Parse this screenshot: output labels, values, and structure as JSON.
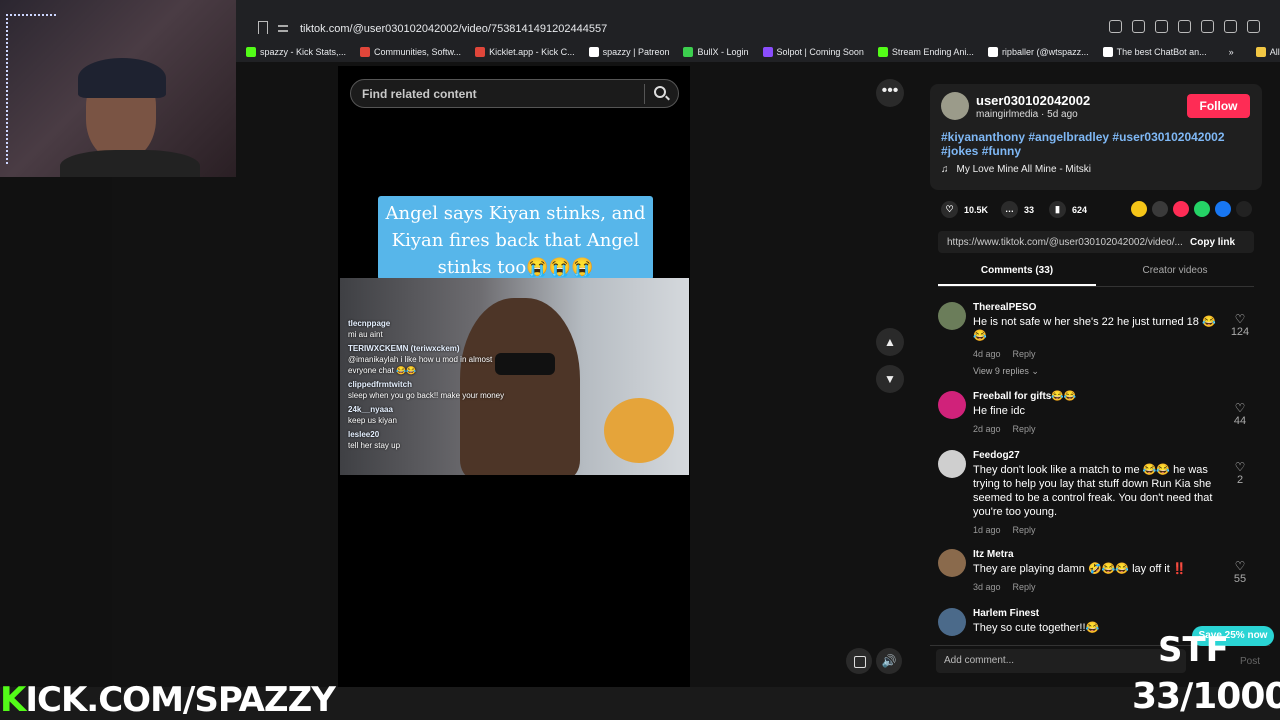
{
  "browser": {
    "url": "tiktok.com/@user030102042002/video/7538141491202444557",
    "bookmarks": [
      {
        "label": "spazzy - Kick Stats,...",
        "color": "#53fc18"
      },
      {
        "label": "Communities, Softw...",
        "color": "#e0463a"
      },
      {
        "label": "Kicklet.app - Kick C...",
        "color": "#e0463a"
      },
      {
        "label": "spazzy | Patreon",
        "color": "#ffffff"
      },
      {
        "label": "BullX - Login",
        "color": "#3ccf4e"
      },
      {
        "label": "Solpot | Coming Soon",
        "color": "#8a4dfd"
      },
      {
        "label": "Stream Ending Ani...",
        "color": "#53fc18"
      },
      {
        "label": "ripballer (@wtspazz...",
        "color": "#ffffff"
      },
      {
        "label": "The best ChatBot an...",
        "color": "#ffffff"
      },
      {
        "label": "All Bookmarks",
        "color": "#f2c744"
      }
    ],
    "bookmarks_more": "»"
  },
  "video": {
    "search_placeholder": "Find related content",
    "caption": "Angel says Kiyan stinks, and Kiyan fires back that Angel stinks too😭😭😭",
    "chat": [
      {
        "name": "tlecnppage",
        "text": "mi au aint"
      },
      {
        "name": "TERIWXCKEMN (teriwxckem)",
        "text": "@imanikaylah i like how u mod in almost evryone chat 😂😂"
      },
      {
        "name": "clippedfrmtwitch",
        "text": "sleep when you go back!! make your money"
      },
      {
        "name": "24k__nyaaa",
        "text": "keep us kiyan"
      },
      {
        "name": "leslee20",
        "text": "tell her stay up"
      }
    ]
  },
  "author": {
    "username": "user030102042002",
    "subline": "maingirlmedia · 5d ago",
    "follow_label": "Follow",
    "hashtags": "#kiyananthony #angelbradley #user030102042002 #jokes #funny",
    "music": "My Love Mine All Mine - Mitski",
    "music_icon": "♫"
  },
  "stats": {
    "likes": "10.5K",
    "comments": "33",
    "saves": "624"
  },
  "share": {
    "link": "https://www.tiktok.com/@user030102042002/video/...",
    "copy_label": "Copy link",
    "colors": [
      "#f5c518",
      "#3a3a3a",
      "#fe2c55",
      "#25d366",
      "#1877f2",
      "#222222"
    ]
  },
  "tabs": {
    "comments": "Comments (33)",
    "creator": "Creator videos"
  },
  "comments": [
    {
      "name": "TherealPESO",
      "text": "He is not safe w her she's 22 he just turned 18 😂😂",
      "ago": "4d ago",
      "reply": "Reply",
      "likes": "124",
      "replies": "View 9 replies ⌄",
      "color": "#6b7d5a"
    },
    {
      "name": "Freeball for gifts😂😂",
      "text": "He fine idc",
      "ago": "2d ago",
      "reply": "Reply",
      "likes": "44",
      "color": "#d0227a"
    },
    {
      "name": "Feedog27",
      "text": "They don't look like a match to me 😂😂 he was trying to help you lay that stuff down Run Kia she seemed to be a control freak. You don't need that you're too young.",
      "ago": "1d ago",
      "reply": "Reply",
      "likes": "2",
      "color": "#cfcfcf"
    },
    {
      "name": "Itz Metra",
      "text": "They are playing damn 🤣😂😂 lay off it ‼️",
      "ago": "3d ago",
      "reply": "Reply",
      "likes": "55",
      "color": "#8a6a4c"
    },
    {
      "name": "Harlem Finest",
      "text": "They so cute together!!😂",
      "color": "#4b6a8a"
    }
  ],
  "add_comment": {
    "placeholder": "Add comment...",
    "post": "Post"
  },
  "overlays": {
    "kick_k": "K",
    "kick_rest": "ICK.COM/SPAZZY",
    "stf": "STF",
    "counter": "33/1000",
    "save_pill": "Save 25% now"
  },
  "icons": {
    "more": "•••",
    "up": "▲",
    "down": "▼",
    "volume": "🔊",
    "heart": "♡"
  }
}
